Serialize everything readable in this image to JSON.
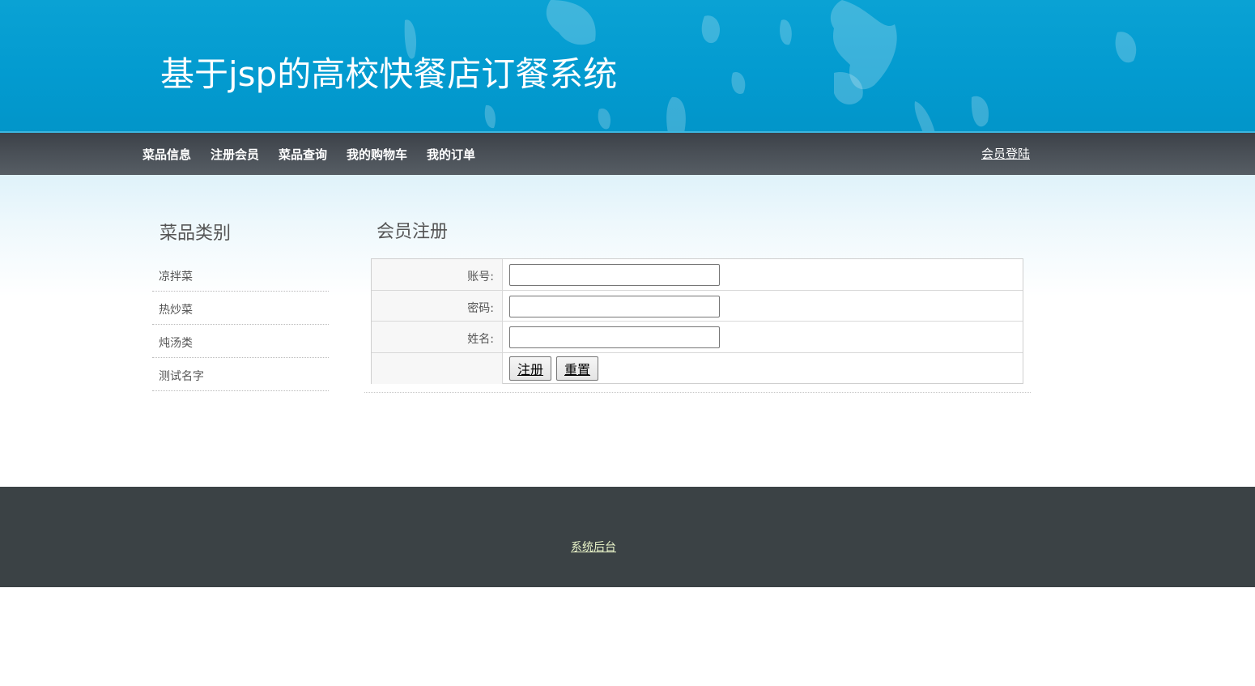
{
  "header": {
    "title": "基于jsp的高校快餐店订餐系统"
  },
  "nav": {
    "items": [
      {
        "label": "菜品信息"
      },
      {
        "label": "注册会员"
      },
      {
        "label": "菜品查询"
      },
      {
        "label": "我的购物车"
      },
      {
        "label": "我的订单"
      }
    ],
    "login_label": "会员登陆"
  },
  "sidebar": {
    "title": "菜品类别",
    "categories": [
      {
        "label": "凉拌菜"
      },
      {
        "label": "热炒菜"
      },
      {
        "label": "炖汤类"
      },
      {
        "label": "测试名字"
      }
    ]
  },
  "main": {
    "title": "会员注册",
    "form": {
      "fields": [
        {
          "label": "账号:",
          "value": ""
        },
        {
          "label": "密码:",
          "value": ""
        },
        {
          "label": "姓名:",
          "value": ""
        }
      ],
      "submit_label": "注册",
      "reset_label": "重置"
    }
  },
  "footer": {
    "admin_link": "系统后台"
  },
  "colors": {
    "header_blue": "#039bd0",
    "nav_dark": "#4a5057",
    "footer_dark": "#3b4245",
    "footer_link": "#e8f3c8"
  }
}
